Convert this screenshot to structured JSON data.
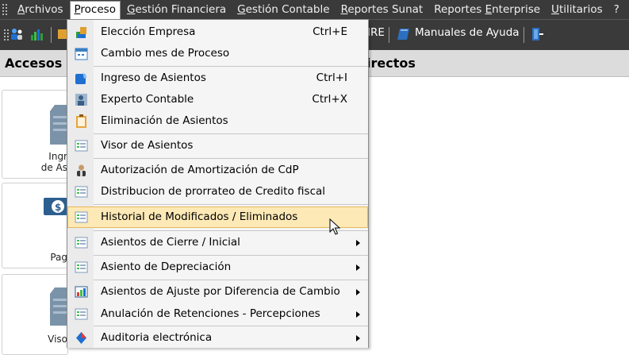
{
  "menubar": {
    "items": [
      {
        "label": "Archivos",
        "u": "A",
        "rest": "rchivos"
      },
      {
        "label": "Proceso",
        "u": "P",
        "rest": "roceso"
      },
      {
        "label": "Gestión Financiera",
        "u": "G",
        "rest": "estión Financiera"
      },
      {
        "label": "Gestión Contable",
        "u": "G",
        "rest": "estión Contable"
      },
      {
        "label": "Reportes Sunat",
        "u": "R",
        "rest": "eportes Sunat"
      },
      {
        "label": "Reportes Enterprise",
        "pre": "Reportes ",
        "u": "E",
        "rest": "nterprise"
      },
      {
        "label": "Utilitarios",
        "u": "U",
        "rest": "tilitarios"
      },
      {
        "label": "?"
      }
    ]
  },
  "toolbar": {
    "partial_text": "IRE",
    "manuals_label": "Manuales de Ayuda"
  },
  "header": {
    "left_title": "Accesos",
    "right_title": "irectos"
  },
  "tiles": [
    {
      "label_line1": "Ingr",
      "label_line2": "de As"
    },
    {
      "label_line1": "Pag"
    },
    {
      "label_line1": "Viso"
    }
  ],
  "dropdown": {
    "items": [
      {
        "label": "Elección Empresa",
        "shortcut": "Ctrl+E",
        "icon": "company-icon"
      },
      {
        "label": "Cambio mes de Proceso",
        "icon": "calendar-icon"
      },
      {
        "label": "Ingreso de Asientos",
        "shortcut": "Ctrl+I",
        "icon": "entry-icon"
      },
      {
        "label": "Experto Contable",
        "shortcut": "Ctrl+X",
        "icon": "expert-icon"
      },
      {
        "label": "Eliminación de Asientos",
        "icon": "clipboard-icon"
      },
      {
        "label": "Visor de Asientos",
        "icon": "form-icon"
      },
      {
        "label": "Autorización de Amortización de CdP",
        "icon": "user-icon"
      },
      {
        "label": "Distribucion de prorrateo de Credito fiscal",
        "icon": "form-icon"
      },
      {
        "label": "Historial de Modificados / Eliminados",
        "icon": "form-icon"
      },
      {
        "label": "Asientos de Cierre / Inicial",
        "icon": "form-icon",
        "submenu": true
      },
      {
        "label": "Asiento de Depreciación",
        "icon": "form-icon",
        "submenu": true
      },
      {
        "label": "Asientos de Ajuste por Diferencia de Cambio",
        "icon": "chart-icon",
        "submenu": true
      },
      {
        "label": "Anulación de Retenciones - Percepciones",
        "icon": "form-icon",
        "submenu": true
      },
      {
        "label": "Auditoria electrónica",
        "icon": "audit-icon",
        "submenu": true
      }
    ]
  }
}
